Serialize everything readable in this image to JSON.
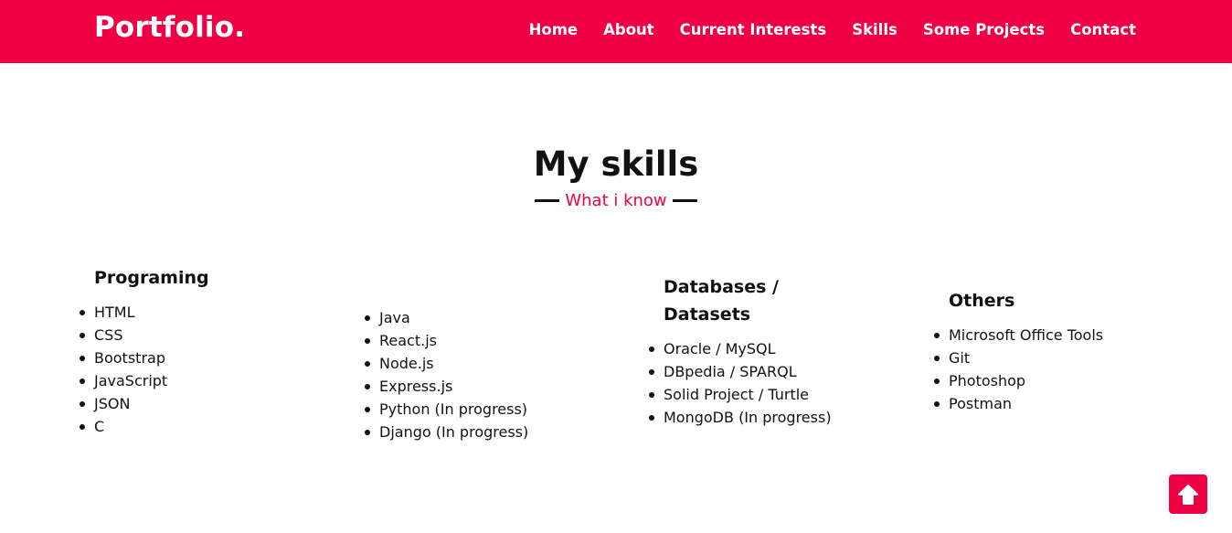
{
  "brand": "Portfolio.",
  "nav": [
    {
      "label": "Home"
    },
    {
      "label": "About"
    },
    {
      "label": "Current Interests"
    },
    {
      "label": "Skills"
    },
    {
      "label": "Some Projects"
    },
    {
      "label": "Contact"
    }
  ],
  "section": {
    "title": "My skills",
    "subtitle": "What i know"
  },
  "columns": [
    {
      "heading": "Programing",
      "items": [
        "HTML",
        "CSS",
        "Bootstrap",
        "JavaScript",
        "JSON",
        "C"
      ]
    },
    {
      "heading": "",
      "items": [
        "Java",
        "React.js",
        "Node.js",
        "Express.js",
        "Python (In progress)",
        "Django (In progress)"
      ]
    },
    {
      "heading": "Databases / Datasets",
      "heading_line1": "Databases /",
      "heading_line2": "Datasets",
      "items": [
        "Oracle / MySQL",
        "DBpedia / SPARQL",
        "Solid Project / Turtle",
        "MongoDB (In progress)"
      ]
    },
    {
      "heading": "Others",
      "items": [
        "Microsoft Office Tools",
        "Git",
        "Photoshop",
        "Postman"
      ]
    }
  ],
  "scroll_top_icon": "arrow-up-icon",
  "colors": {
    "accent": "#ef0042",
    "text": "#111111",
    "background": "#ffffff"
  }
}
